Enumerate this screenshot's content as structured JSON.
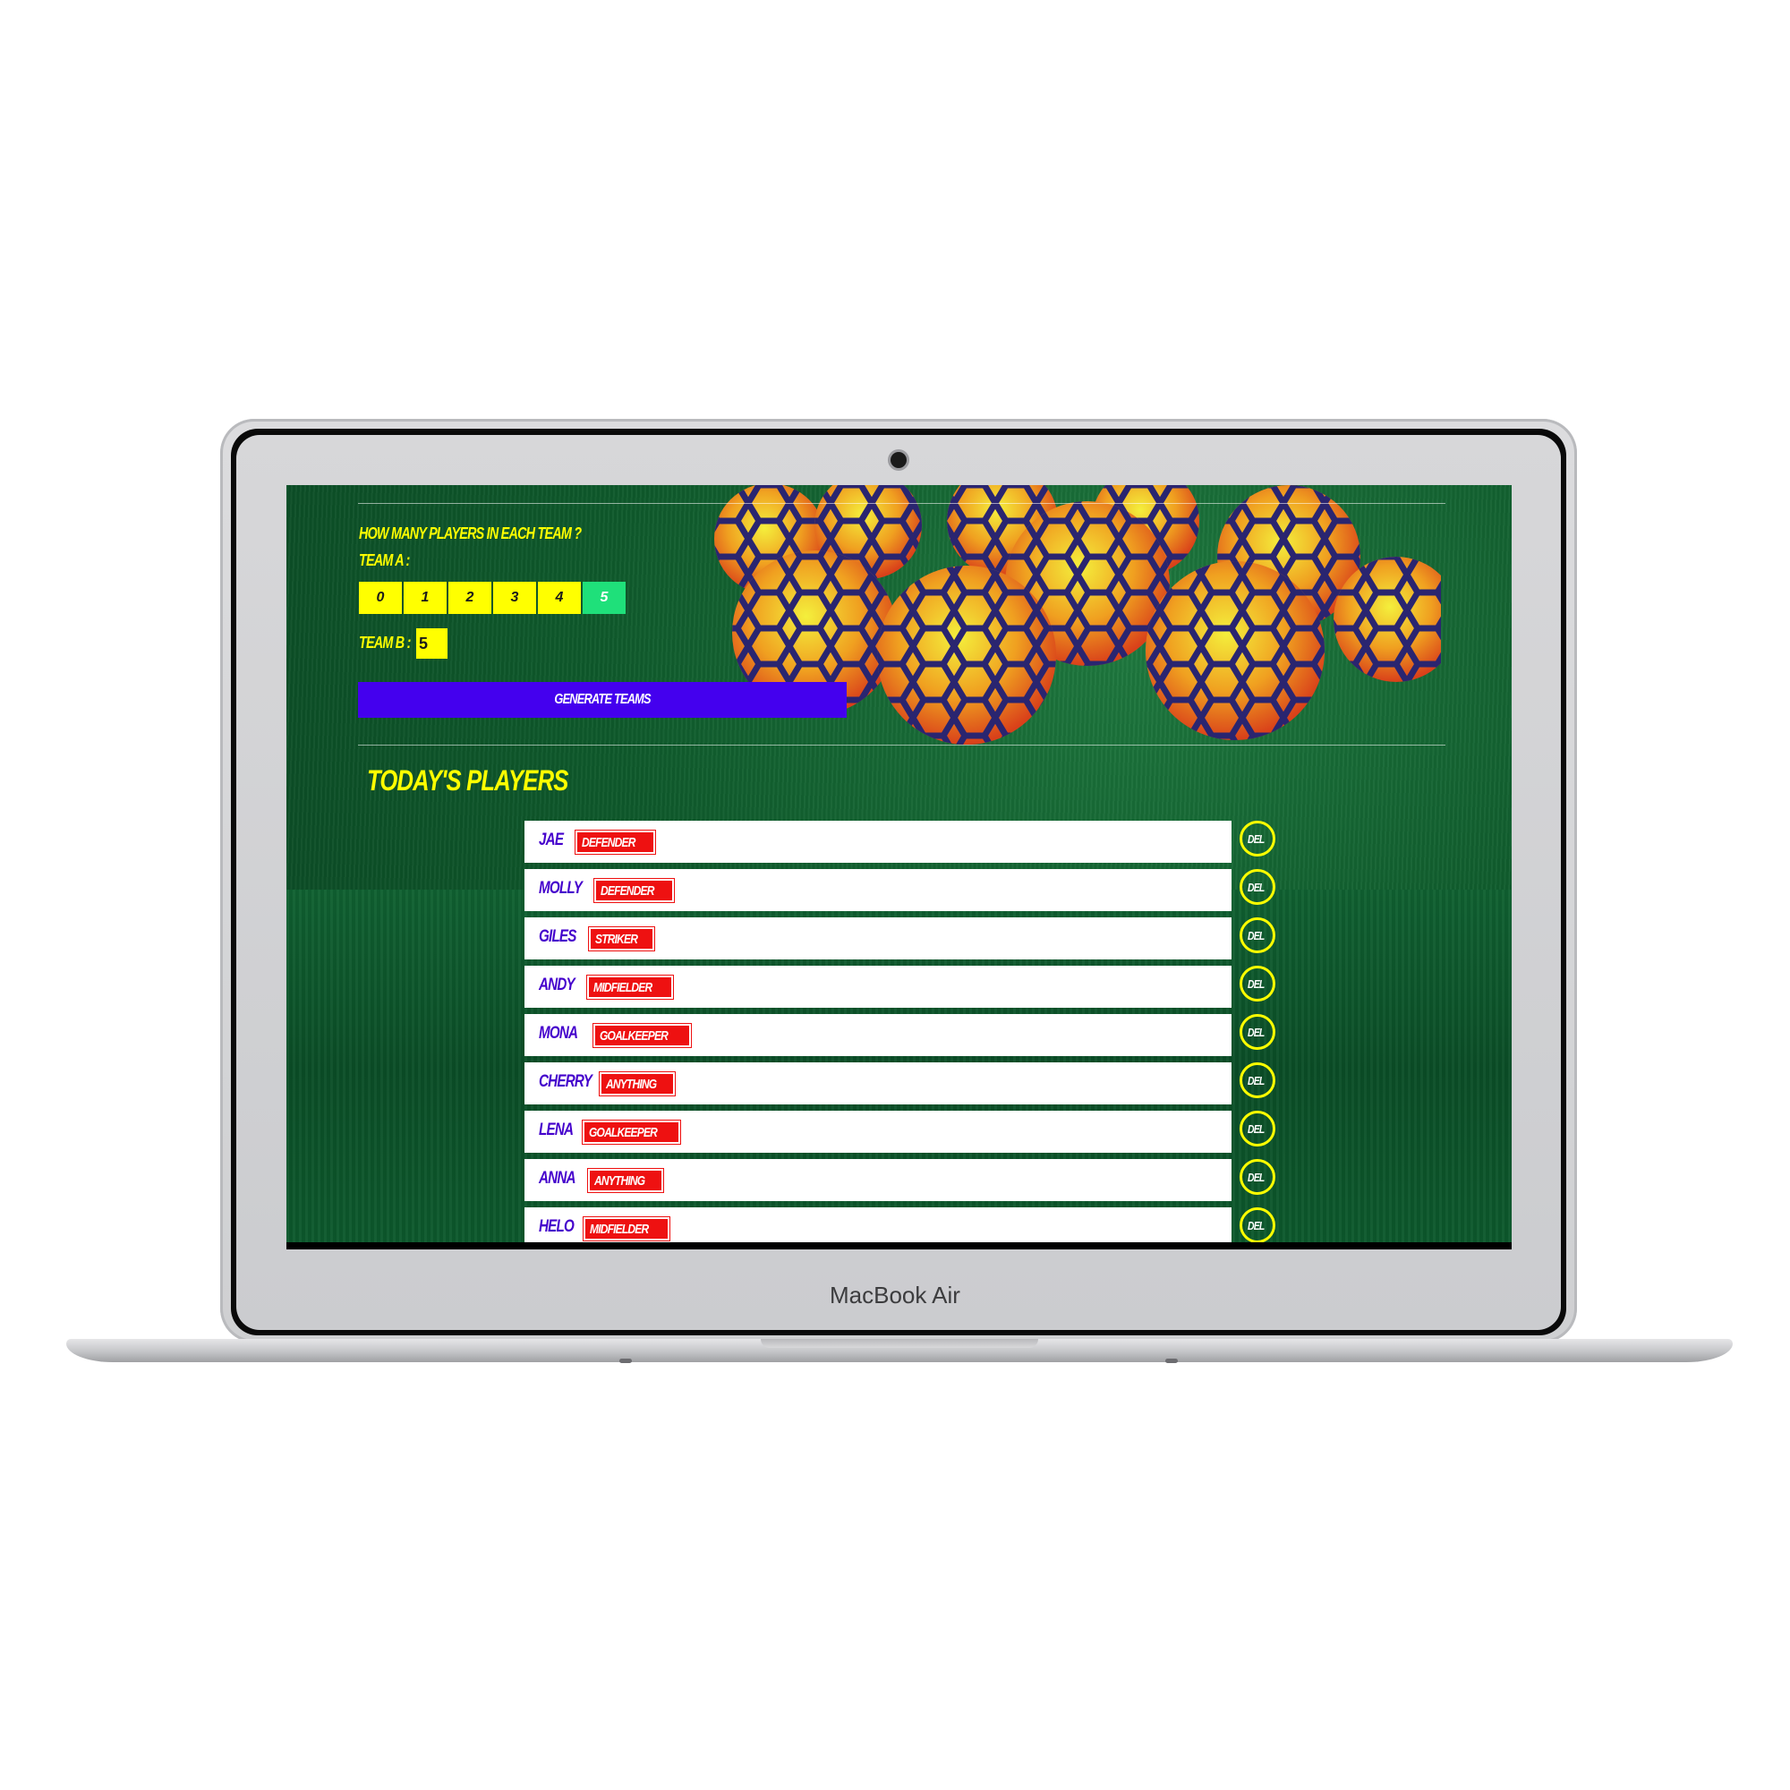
{
  "device": {
    "brand": "MacBook Air"
  },
  "app": {
    "question": "HOW MANY PLAYERS IN EACH TEAM ?",
    "team_a_label": "TEAM A :",
    "team_a_options": [
      "0",
      "1",
      "2",
      "3",
      "4",
      "5"
    ],
    "team_a_selected": "5",
    "team_b_label": "TEAM B :",
    "team_b_value": "5",
    "generate_button": "GENERATE TEAMS",
    "section_title": "TODAY'S PLAYERS",
    "delete_label": "DEL",
    "players": [
      {
        "name": "JAE",
        "position": "DEFENDER"
      },
      {
        "name": "MOLLY",
        "position": "DEFENDER"
      },
      {
        "name": "GILES",
        "position": "STRIKER"
      },
      {
        "name": "ANDY",
        "position": "MIDFIELDER"
      },
      {
        "name": "MONA",
        "position": "GOALKEEPER"
      },
      {
        "name": "CHERRY",
        "position": "ANYTHING"
      },
      {
        "name": "LENA",
        "position": "GOALKEEPER"
      },
      {
        "name": "ANNA",
        "position": "ANYTHING"
      },
      {
        "name": "HELO",
        "position": "MIDFIELDER"
      }
    ]
  },
  "colors": {
    "accent_yellow": "#ffff00",
    "selected_green": "#1fe07a",
    "button_purple": "#4400ee",
    "badge_red": "#ee1111",
    "name_purple": "#4400cc",
    "field_green": "#0f5a2c"
  }
}
